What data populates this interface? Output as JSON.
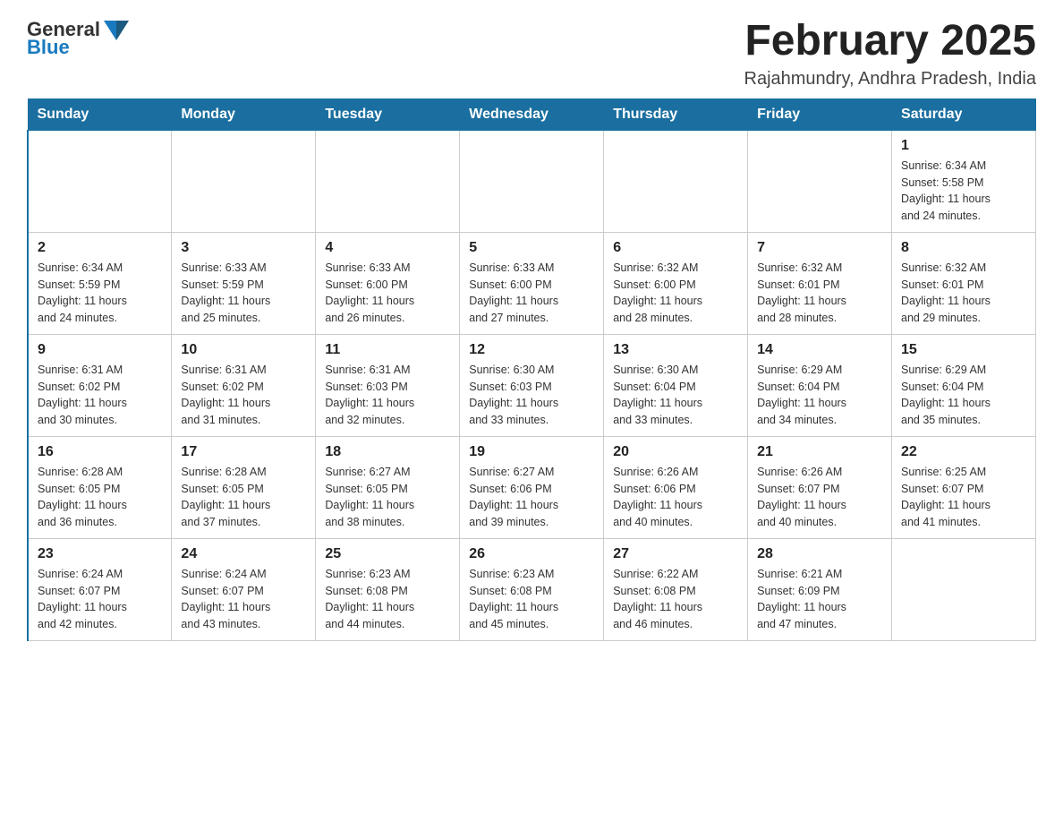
{
  "header": {
    "logo_general": "General",
    "logo_blue": "Blue",
    "title": "February 2025",
    "location": "Rajahmundry, Andhra Pradesh, India"
  },
  "days_of_week": [
    "Sunday",
    "Monday",
    "Tuesday",
    "Wednesday",
    "Thursday",
    "Friday",
    "Saturday"
  ],
  "weeks": [
    [
      {
        "day": "",
        "info": ""
      },
      {
        "day": "",
        "info": ""
      },
      {
        "day": "",
        "info": ""
      },
      {
        "day": "",
        "info": ""
      },
      {
        "day": "",
        "info": ""
      },
      {
        "day": "",
        "info": ""
      },
      {
        "day": "1",
        "info": "Sunrise: 6:34 AM\nSunset: 5:58 PM\nDaylight: 11 hours\nand 24 minutes."
      }
    ],
    [
      {
        "day": "2",
        "info": "Sunrise: 6:34 AM\nSunset: 5:59 PM\nDaylight: 11 hours\nand 24 minutes."
      },
      {
        "day": "3",
        "info": "Sunrise: 6:33 AM\nSunset: 5:59 PM\nDaylight: 11 hours\nand 25 minutes."
      },
      {
        "day": "4",
        "info": "Sunrise: 6:33 AM\nSunset: 6:00 PM\nDaylight: 11 hours\nand 26 minutes."
      },
      {
        "day": "5",
        "info": "Sunrise: 6:33 AM\nSunset: 6:00 PM\nDaylight: 11 hours\nand 27 minutes."
      },
      {
        "day": "6",
        "info": "Sunrise: 6:32 AM\nSunset: 6:00 PM\nDaylight: 11 hours\nand 28 minutes."
      },
      {
        "day": "7",
        "info": "Sunrise: 6:32 AM\nSunset: 6:01 PM\nDaylight: 11 hours\nand 28 minutes."
      },
      {
        "day": "8",
        "info": "Sunrise: 6:32 AM\nSunset: 6:01 PM\nDaylight: 11 hours\nand 29 minutes."
      }
    ],
    [
      {
        "day": "9",
        "info": "Sunrise: 6:31 AM\nSunset: 6:02 PM\nDaylight: 11 hours\nand 30 minutes."
      },
      {
        "day": "10",
        "info": "Sunrise: 6:31 AM\nSunset: 6:02 PM\nDaylight: 11 hours\nand 31 minutes."
      },
      {
        "day": "11",
        "info": "Sunrise: 6:31 AM\nSunset: 6:03 PM\nDaylight: 11 hours\nand 32 minutes."
      },
      {
        "day": "12",
        "info": "Sunrise: 6:30 AM\nSunset: 6:03 PM\nDaylight: 11 hours\nand 33 minutes."
      },
      {
        "day": "13",
        "info": "Sunrise: 6:30 AM\nSunset: 6:04 PM\nDaylight: 11 hours\nand 33 minutes."
      },
      {
        "day": "14",
        "info": "Sunrise: 6:29 AM\nSunset: 6:04 PM\nDaylight: 11 hours\nand 34 minutes."
      },
      {
        "day": "15",
        "info": "Sunrise: 6:29 AM\nSunset: 6:04 PM\nDaylight: 11 hours\nand 35 minutes."
      }
    ],
    [
      {
        "day": "16",
        "info": "Sunrise: 6:28 AM\nSunset: 6:05 PM\nDaylight: 11 hours\nand 36 minutes."
      },
      {
        "day": "17",
        "info": "Sunrise: 6:28 AM\nSunset: 6:05 PM\nDaylight: 11 hours\nand 37 minutes."
      },
      {
        "day": "18",
        "info": "Sunrise: 6:27 AM\nSunset: 6:05 PM\nDaylight: 11 hours\nand 38 minutes."
      },
      {
        "day": "19",
        "info": "Sunrise: 6:27 AM\nSunset: 6:06 PM\nDaylight: 11 hours\nand 39 minutes."
      },
      {
        "day": "20",
        "info": "Sunrise: 6:26 AM\nSunset: 6:06 PM\nDaylight: 11 hours\nand 40 minutes."
      },
      {
        "day": "21",
        "info": "Sunrise: 6:26 AM\nSunset: 6:07 PM\nDaylight: 11 hours\nand 40 minutes."
      },
      {
        "day": "22",
        "info": "Sunrise: 6:25 AM\nSunset: 6:07 PM\nDaylight: 11 hours\nand 41 minutes."
      }
    ],
    [
      {
        "day": "23",
        "info": "Sunrise: 6:24 AM\nSunset: 6:07 PM\nDaylight: 11 hours\nand 42 minutes."
      },
      {
        "day": "24",
        "info": "Sunrise: 6:24 AM\nSunset: 6:07 PM\nDaylight: 11 hours\nand 43 minutes."
      },
      {
        "day": "25",
        "info": "Sunrise: 6:23 AM\nSunset: 6:08 PM\nDaylight: 11 hours\nand 44 minutes."
      },
      {
        "day": "26",
        "info": "Sunrise: 6:23 AM\nSunset: 6:08 PM\nDaylight: 11 hours\nand 45 minutes."
      },
      {
        "day": "27",
        "info": "Sunrise: 6:22 AM\nSunset: 6:08 PM\nDaylight: 11 hours\nand 46 minutes."
      },
      {
        "day": "28",
        "info": "Sunrise: 6:21 AM\nSunset: 6:09 PM\nDaylight: 11 hours\nand 47 minutes."
      },
      {
        "day": "",
        "info": ""
      }
    ]
  ]
}
